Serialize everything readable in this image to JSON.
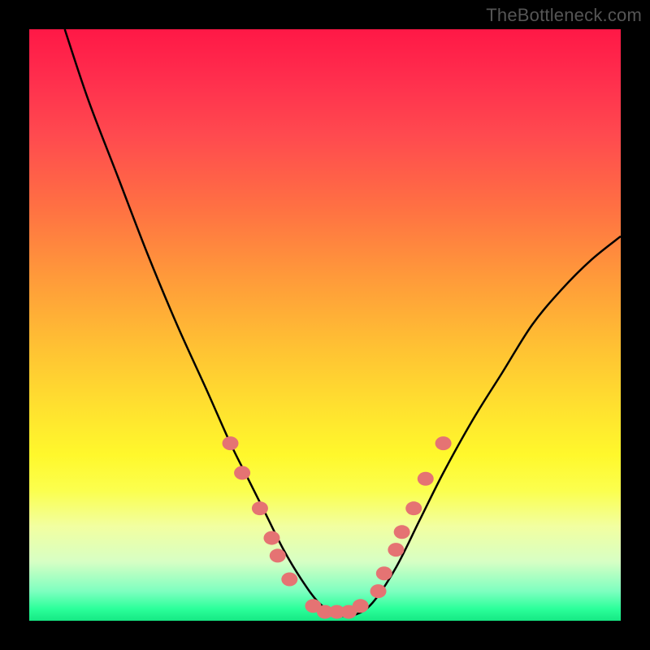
{
  "watermark": "TheBottleneck.com",
  "chart_data": {
    "type": "line",
    "title": "",
    "xlabel": "",
    "ylabel": "",
    "xlim": [
      0,
      100
    ],
    "ylim": [
      0,
      100
    ],
    "grid": false,
    "legend": false,
    "annotations": [],
    "series": [
      {
        "name": "curve",
        "color": "#000000",
        "x": [
          6,
          10,
          15,
          20,
          25,
          30,
          34,
          37,
          40,
          43,
          46,
          49,
          52,
          55,
          58,
          62,
          66,
          70,
          75,
          80,
          85,
          90,
          95,
          100
        ],
        "y": [
          100,
          88,
          75,
          62,
          50,
          39,
          30,
          24,
          18,
          12,
          7,
          3,
          1,
          1,
          3,
          9,
          17,
          25,
          34,
          42,
          50,
          56,
          61,
          65
        ]
      }
    ],
    "markers": [
      {
        "name": "dots",
        "color": "#e57373",
        "r": 10,
        "points": [
          {
            "x": 34,
            "y": 30
          },
          {
            "x": 36,
            "y": 25
          },
          {
            "x": 39,
            "y": 19
          },
          {
            "x": 41,
            "y": 14
          },
          {
            "x": 42,
            "y": 11
          },
          {
            "x": 44,
            "y": 7
          },
          {
            "x": 48,
            "y": 2.5
          },
          {
            "x": 50,
            "y": 1.5
          },
          {
            "x": 52,
            "y": 1.5
          },
          {
            "x": 54,
            "y": 1.5
          },
          {
            "x": 56,
            "y": 2.5
          },
          {
            "x": 59,
            "y": 5
          },
          {
            "x": 60,
            "y": 8
          },
          {
            "x": 62,
            "y": 12
          },
          {
            "x": 63,
            "y": 15
          },
          {
            "x": 65,
            "y": 19
          },
          {
            "x": 67,
            "y": 24
          },
          {
            "x": 70,
            "y": 30
          }
        ]
      }
    ]
  }
}
